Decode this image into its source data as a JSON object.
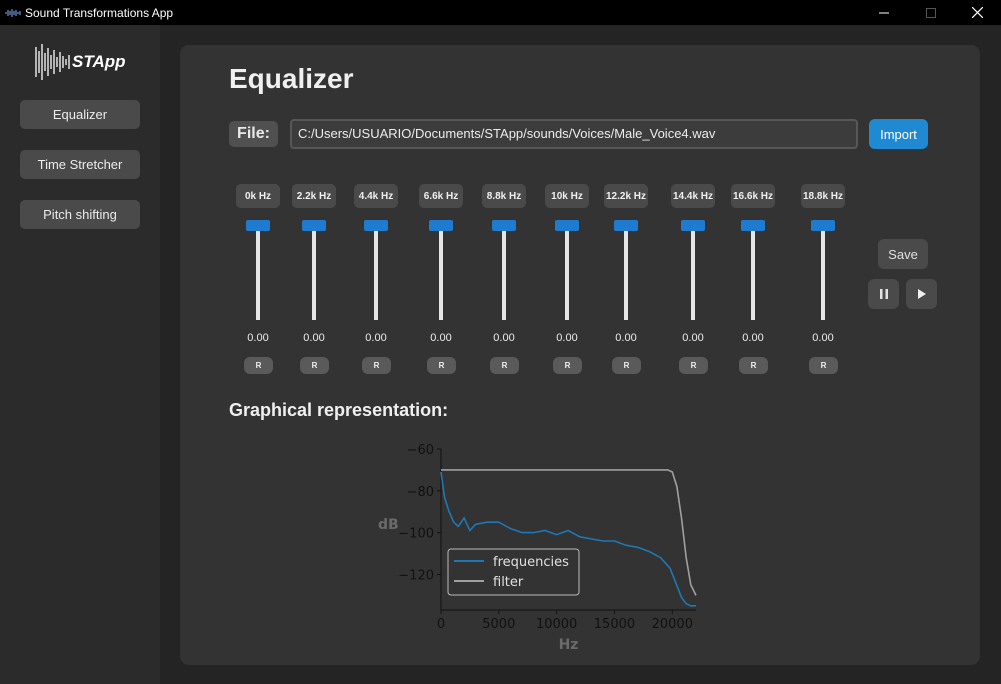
{
  "window": {
    "title": "Sound Transformations App"
  },
  "logo": {
    "text": "STApp"
  },
  "sidebar": {
    "items": [
      {
        "label": "Equalizer"
      },
      {
        "label": "Time Stretcher"
      },
      {
        "label": "Pitch shifting"
      }
    ]
  },
  "main": {
    "title": "Equalizer",
    "file_label": "File:",
    "file_path": "C:/Users/USUARIO/Documents/STApp/sounds/Voices/Male_Voice4.wav",
    "import_label": "Import",
    "save_label": "Save",
    "graph_title": "Graphical representation:",
    "reset_label": "R",
    "bands": [
      {
        "label": "0k Hz",
        "value": "0.00"
      },
      {
        "label": "2.2k Hz",
        "value": "0.00"
      },
      {
        "label": "4.4k Hz",
        "value": "0.00"
      },
      {
        "label": "6.6k Hz",
        "value": "0.00"
      },
      {
        "label": "8.8k Hz",
        "value": "0.00"
      },
      {
        "label": "10k Hz",
        "value": "0.00"
      },
      {
        "label": "12.2k Hz",
        "value": "0.00"
      },
      {
        "label": "14.4k Hz",
        "value": "0.00"
      },
      {
        "label": "16.6k Hz",
        "value": "0.00"
      },
      {
        "label": "18.8k Hz",
        "value": "0.00"
      }
    ]
  },
  "colors": {
    "accent": "#1f8ad2",
    "slider": "#1f7bd0",
    "panel": "#333333",
    "sidebar": "#2b2b2b"
  },
  "icons": {
    "pause": "pause-icon",
    "play": "play-icon"
  },
  "chart_data": {
    "type": "line",
    "xlabel": "Hz",
    "ylabel": "dB",
    "xlim": [
      0,
      22050
    ],
    "ylim": [
      -137,
      -60
    ],
    "xticks": [
      0,
      5000,
      10000,
      15000,
      20000
    ],
    "yticks": [
      -60,
      -80,
      -100,
      -120
    ],
    "legend": "bottom-left",
    "series": [
      {
        "name": "frequencies",
        "color": "#1f77b4",
        "x": [
          0,
          300,
          700,
          1100,
          1500,
          2000,
          2500,
          3000,
          4000,
          5000,
          6000,
          7000,
          8000,
          9000,
          10000,
          11000,
          12000,
          13000,
          14000,
          15000,
          16000,
          17000,
          18000,
          19000,
          19800,
          20300,
          20800,
          21200,
          21600,
          22050
        ],
        "y": [
          -71,
          -83,
          -90,
          -95,
          -97,
          -93,
          -99,
          -96,
          -95,
          -95,
          -98,
          -100,
          -100,
          -99,
          -101,
          -99,
          -102,
          -103,
          -104,
          -104,
          -106,
          -107,
          -109,
          -112,
          -117,
          -124,
          -131,
          -134,
          -135,
          -135
        ]
      },
      {
        "name": "filter",
        "color": "#a0a0a0",
        "x": [
          0,
          19000,
          19600,
          20000,
          20400,
          20800,
          21200,
          21600,
          22050
        ],
        "y": [
          -70,
          -70,
          -70,
          -71,
          -78,
          -93,
          -112,
          -125,
          -130
        ]
      }
    ]
  }
}
